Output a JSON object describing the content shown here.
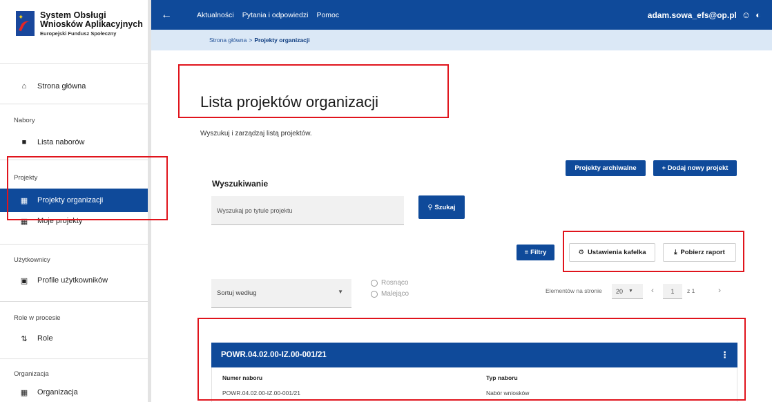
{
  "app": {
    "logo_line1": "System Obsługi",
    "logo_line2": "Wniosków Aplikacyjnych",
    "logo_line3": "Europejski Fundusz Społeczny"
  },
  "sidebar": {
    "home": "Strona główna",
    "sections": {
      "nabory": "Nabory",
      "projekty": "Projekty",
      "uzytkownicy": "Użytkownicy",
      "role": "Role w procesie",
      "organizacja": "Organizacja"
    },
    "items": {
      "lista_naborow": "Lista naborów",
      "projekty_organizacji": "Projekty organizacji",
      "moje_projekty": "Moje projekty",
      "profile_uzytkownikow": "Profile użytkowników",
      "role": "Role",
      "organizacja": "Organizacja"
    }
  },
  "topbar": {
    "back_icon": "←",
    "links": [
      "Aktualności",
      "Pytania i odpowiedzi",
      "Pomoc"
    ],
    "user_email": "adam.sowa_efs@op.pl"
  },
  "breadcrumb": {
    "home": "Strona główna",
    "separator": ">",
    "current": "Projekty organizacji"
  },
  "main": {
    "title": "Lista projektów organizacji",
    "subtitle": "Wyszukuj i zarządzaj listą projektów.",
    "archived_button": "Projekty archiwalne",
    "add_button": "+ Dodaj nowy projekt",
    "search_heading": "Wyszukiwanie",
    "search_placeholder": "Wyszukaj po tytule projektu",
    "search_button": "Szukaj",
    "filters_button": "Filtry",
    "tile_settings_button": "Ustawienia kafelka",
    "report_button": "Pobierz raport",
    "sort_label": "Sortuj według",
    "sort_asc": "Rosnąco",
    "sort_desc": "Malejąco",
    "per_page_label": "Elementów na stronie",
    "per_page_value": "20",
    "page_value": "1",
    "page_of": "z 1"
  },
  "project_card": {
    "title": "POWR.04.02.00-IZ.00-001/21",
    "fields": [
      {
        "label": "Numer naboru",
        "value": "POWR.04.02.00-IZ.00-001/21"
      },
      {
        "label": "Typ naboru",
        "value": "Nabór wniosków"
      }
    ]
  },
  "colors": {
    "primary": "#0f4a9a",
    "breadcrumb_bg": "#dbe8f6",
    "highlight": "#e0141c"
  }
}
